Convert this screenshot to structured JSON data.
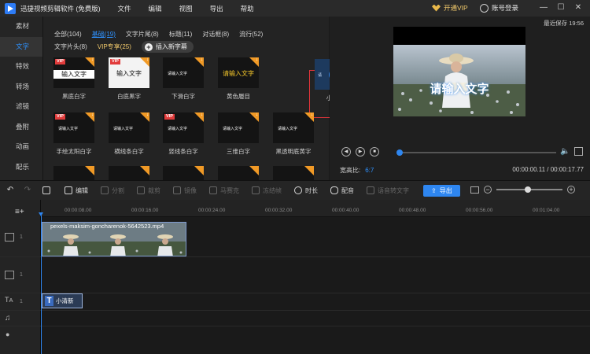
{
  "app": {
    "title": "迅捷视频剪辑软件 (免费版)"
  },
  "menu": [
    "文件",
    "编辑",
    "视图",
    "导出",
    "帮助"
  ],
  "titlebar": {
    "vip_label": "开通VIP",
    "login_label": "账号登录",
    "minimize": "—",
    "maximize": "☐",
    "close": "✕"
  },
  "side_tabs": [
    {
      "label": "素材",
      "active": false
    },
    {
      "label": "文字",
      "active": true
    },
    {
      "label": "特效",
      "active": false
    },
    {
      "label": "转场",
      "active": false
    },
    {
      "label": "滤镜",
      "active": false
    },
    {
      "label": "叠附",
      "active": false
    },
    {
      "label": "动画",
      "active": false
    },
    {
      "label": "配乐",
      "active": false
    }
  ],
  "categories_row1": [
    {
      "label": "全部(104)",
      "active": false
    },
    {
      "label": "基础(19)",
      "active": true
    },
    {
      "label": "文字片尾(8)",
      "active": false
    },
    {
      "label": "标题(11)",
      "active": false
    },
    {
      "label": "对话框(8)",
      "active": false
    },
    {
      "label": "流行(52)",
      "active": false
    }
  ],
  "categories_row2": [
    {
      "label": "文字片头(8)"
    },
    {
      "label": "VIP专享(25)"
    }
  ],
  "insert_button": "插入新字幕",
  "templates_row1": [
    {
      "label": "黑底白字",
      "text": "输入文字",
      "vip": "VIP",
      "style": "dark"
    },
    {
      "label": "白底黑字",
      "text": "输入文字",
      "vip": "VIP",
      "style": "light"
    },
    {
      "label": "下滑白字",
      "text": "请输入文字",
      "vip": "",
      "style": "small"
    },
    {
      "label": "黄色履目",
      "text": "请输入文字",
      "vip": "",
      "style": "gold"
    },
    {
      "label": "小清新",
      "text": "请",
      "vip": "",
      "style": "selected"
    }
  ],
  "templates_row2": [
    {
      "label": "手绘太阳白字",
      "text": "请输入文字",
      "vip": "VIP"
    },
    {
      "label": "横线条白字",
      "text": "请输入文字",
      "vip": ""
    },
    {
      "label": "竖线条白字",
      "text": "请输入文字",
      "vip": "VIP"
    },
    {
      "label": "三维白字",
      "text": "请输入文字",
      "vip": ""
    },
    {
      "label": "黑透明底黄字",
      "text": "请输入文字",
      "vip": ""
    }
  ],
  "preview": {
    "last_save": "最近保存 19:56",
    "caption": "请输入文字",
    "aspect_label": "宽高比:",
    "aspect_value": "6:7",
    "timecode": "00:00:00.11 / 00:00:17.77",
    "progress": 0.0
  },
  "toolbar": {
    "undo": "↶",
    "redo": "↷",
    "edit": "编辑",
    "split": "分割",
    "crop": "裁剪",
    "rotate": "镜像",
    "mosaic": "马赛克",
    "freeze": "冻结帧",
    "duration": "时长",
    "dub": "配音",
    "tts": "语音转文字",
    "export": "导出"
  },
  "timeline": {
    "ticks": [
      "00:00:00.00",
      "00:00:08.00",
      "00:00:16.00",
      "00:00:24.00",
      "00:00:32.00",
      "00:00:40.00",
      "00:00:48.00",
      "00:00:56.00",
      "00:01:04.00"
    ],
    "video_clip_name": "pexels-maksim-goncharenok-5642523.mp4",
    "text_clip_name": "小清新",
    "track_numbers": [
      "1",
      "1",
      "1"
    ],
    "zoom_level": 0.48
  },
  "colors": {
    "accent": "#2e86f0",
    "vip": "#f1c96b",
    "selected_border": "#e0343a",
    "bg": "#1b1b1b"
  }
}
